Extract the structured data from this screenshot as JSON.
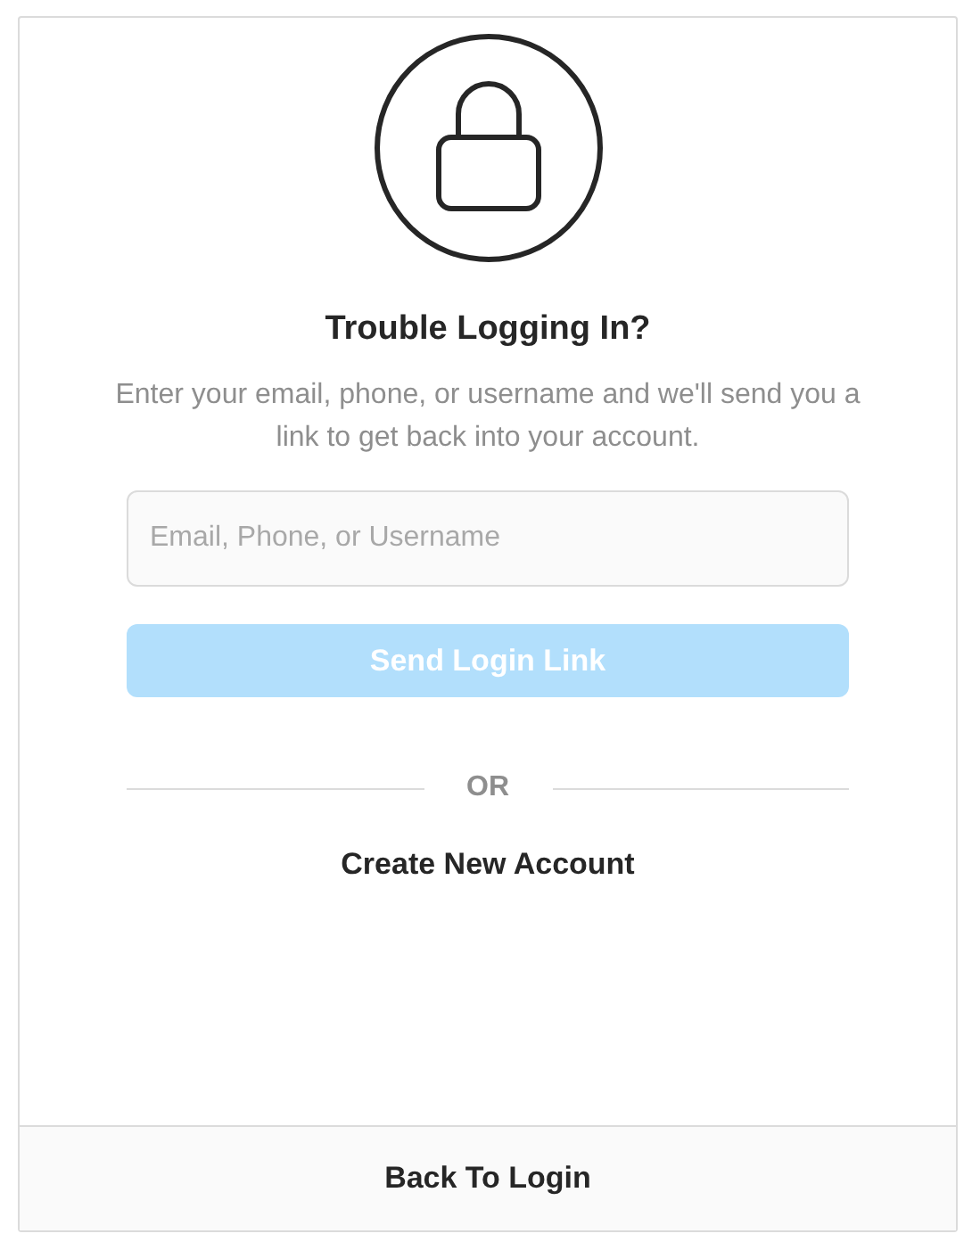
{
  "title": "Trouble Logging In?",
  "description": "Enter your email, phone, or username and we'll send you a link to get back into your account.",
  "identifier_field": {
    "placeholder": "Email, Phone, or Username"
  },
  "send_button": {
    "label": "Send Login Link",
    "disabled": true
  },
  "divider": {
    "label": "OR"
  },
  "create_account_link": {
    "label": "Create New Account"
  },
  "back_to_login": {
    "label": "Back To Login"
  }
}
